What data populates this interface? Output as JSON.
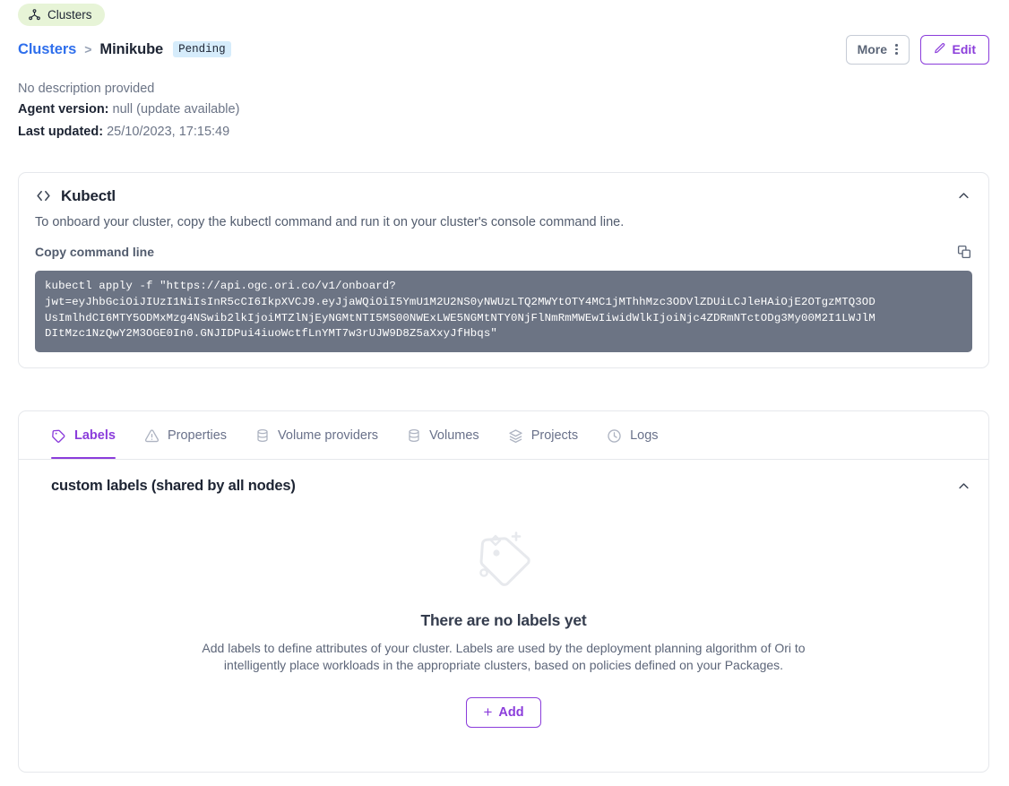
{
  "top_pill": {
    "label": "Clusters",
    "icon": "cluster-nodes-icon",
    "bg": "#e7f4d7"
  },
  "breadcrumb": {
    "parent": "Clusters",
    "separator": ">",
    "current": "Minikube",
    "status": "Pending",
    "status_bg": "#d6ecfb"
  },
  "actions": {
    "more_label": "More",
    "edit_label": "Edit",
    "accent": "#8b3ddb"
  },
  "meta": {
    "description": "No description provided",
    "agent_version_key": "Agent version:",
    "agent_version_value": "null (update available)",
    "last_updated_key": "Last updated:",
    "last_updated_value": "25/10/2023, 17:15:49"
  },
  "kubectl": {
    "title": "Kubectl",
    "subtitle": "To onboard your cluster, copy the kubectl command and run it on your cluster's console command line.",
    "copy_label": "Copy command line",
    "command": "kubectl apply -f \"https://api.ogc.ori.co/v1/onboard?\njwt=eyJhbGciOiJIUzI1NiIsInR5cCI6IkpXVCJ9.eyJjaWQiOiI5YmU1M2U2NS0yNWUzLTQ2MWYtOTY4MC1jMThhMzc3ODVlZDUiLCJleHAiOjE2OTgzMTQ3OD\nUsImlhdCI6MTY5ODMxMzg4NSwib2lkIjoiMTZlNjEyNGMtNTI5MS00NWExLWE5NGMtNTY0NjFlNmRmMWEwIiwidWlkIjoiNjc4ZDRmNTctODg3My00M2I1LWJlM\nDItMzc1NzQwY2M3OGE0In0.GNJIDPui4iuoWctfLnYMT7w3rUJW9D8Z5aXxyJfHbqs\"",
    "code_bg": "#6c7484"
  },
  "tabs": [
    {
      "label": "Labels",
      "icon": "tag-icon",
      "active": true
    },
    {
      "label": "Properties",
      "icon": "warning-triangle-icon",
      "active": false
    },
    {
      "label": "Volume providers",
      "icon": "database-icon",
      "active": false
    },
    {
      "label": "Volumes",
      "icon": "database-icon",
      "active": false
    },
    {
      "label": "Projects",
      "icon": "layers-icon",
      "active": false
    },
    {
      "label": "Logs",
      "icon": "clock-icon",
      "active": false
    }
  ],
  "labels_section": {
    "title": "custom labels (shared by all nodes)",
    "empty_title": "There are no labels yet",
    "empty_body": "Add labels to define attributes of your cluster. Labels are used by the deployment planning algorithm of Ori to intelligently place workloads in the appropriate clusters, based on policies defined on your Packages.",
    "add_label": "Add"
  }
}
